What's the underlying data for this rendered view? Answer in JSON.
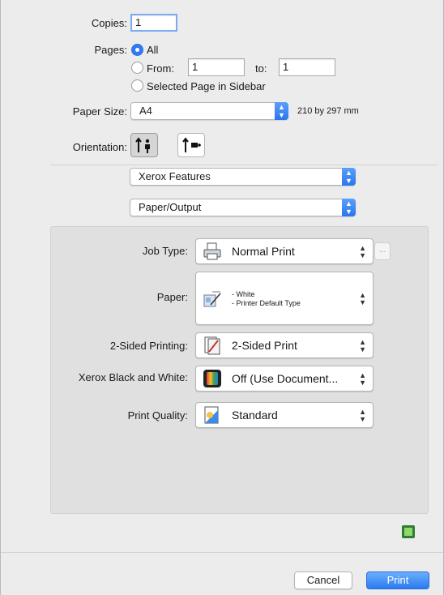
{
  "copies": {
    "label": "Copies:",
    "value": "1"
  },
  "pages": {
    "label": "Pages:",
    "all_label": "All",
    "from_label": "From:",
    "from_value": "1",
    "to_label": "to:",
    "to_value": "1",
    "sidebar_label": "Selected Page in Sidebar",
    "selected": "all"
  },
  "paper_size": {
    "label": "Paper Size:",
    "value": "A4",
    "dimensions": "210 by 297 mm"
  },
  "orientation": {
    "label": "Orientation:",
    "selected": "portrait"
  },
  "section_popup": {
    "value": "Xerox Features"
  },
  "subsection_popup": {
    "value": "Paper/Output"
  },
  "xerox": {
    "job_type": {
      "label": "Job Type:",
      "value": "Normal Print",
      "more_label": "..."
    },
    "paper": {
      "label": "Paper:",
      "line1": "- White",
      "line2": "- Printer Default Type"
    },
    "two_sided": {
      "label": "2-Sided Printing:",
      "value": "2-Sided Print"
    },
    "black_white": {
      "label": "Xerox Black and White:",
      "value": "Off (Use Document..."
    },
    "print_quality": {
      "label": "Print Quality:",
      "value": "Standard"
    }
  },
  "buttons": {
    "cancel": "Cancel",
    "print": "Print"
  },
  "colors": {
    "accent": "#2f7bf5",
    "panel": "#e0e0e0",
    "status_icon": "#3faa3f"
  }
}
